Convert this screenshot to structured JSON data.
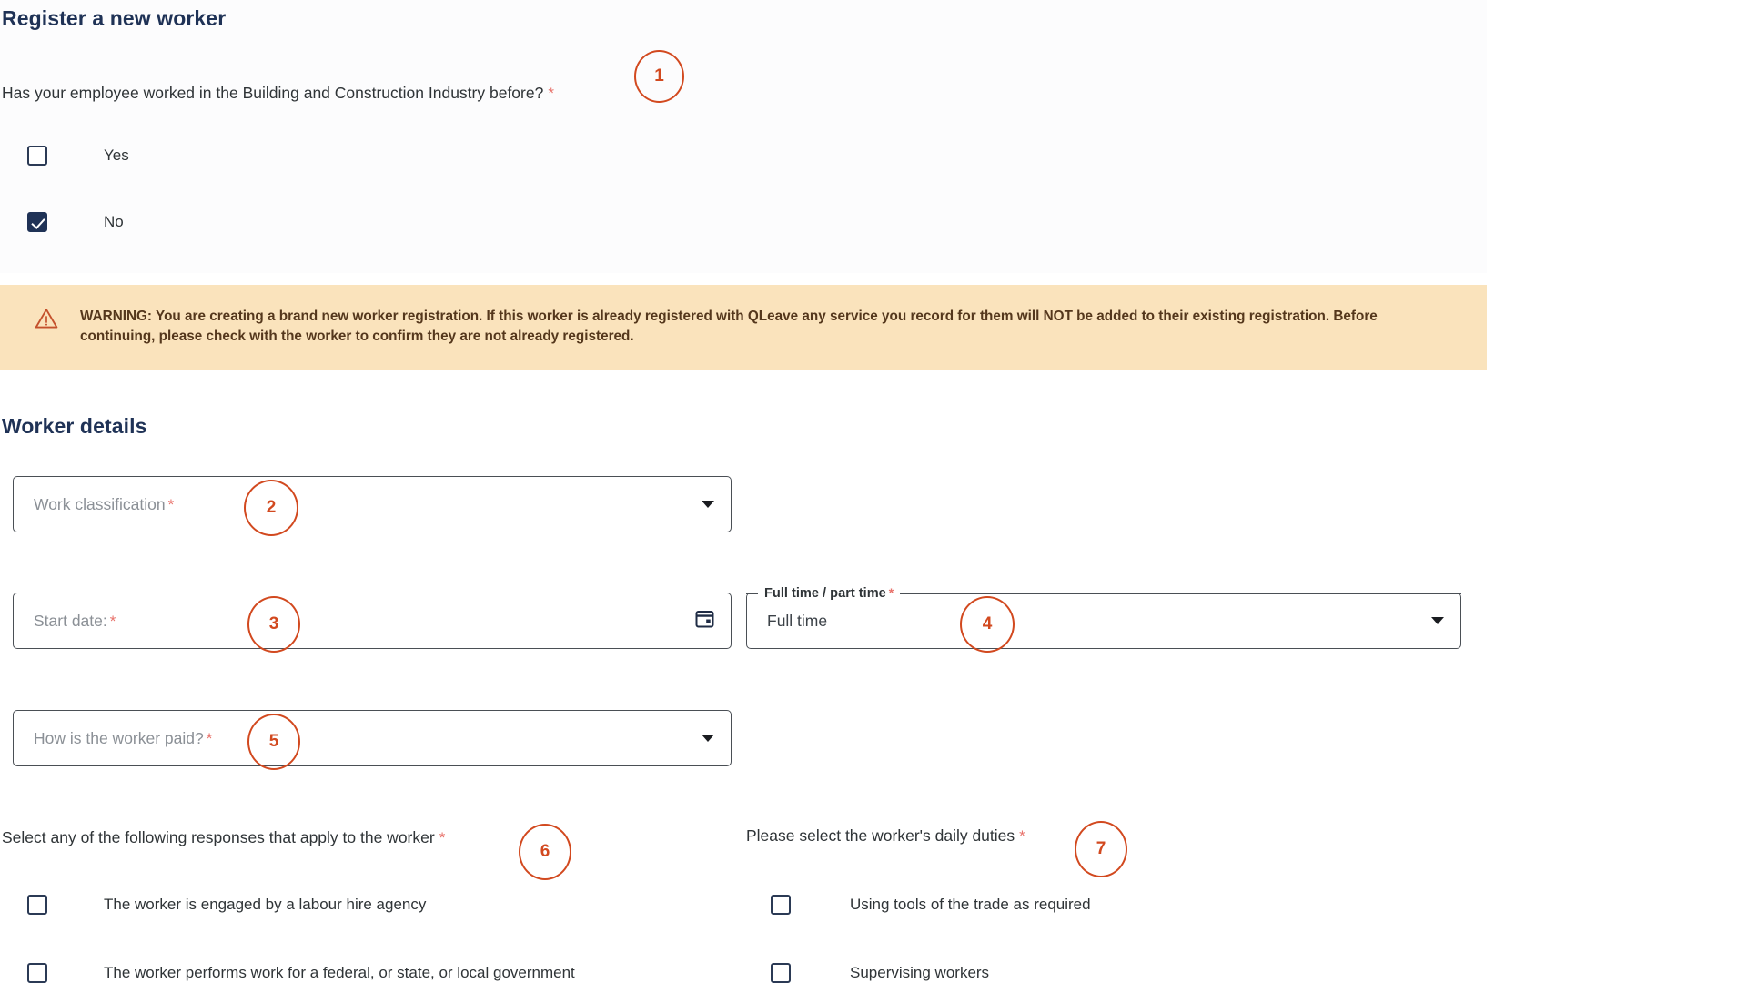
{
  "colors": {
    "heading": "#1f3256",
    "annotation": "#d2491f",
    "warning_bg": "#fae3bc",
    "warning_text": "#54371c",
    "required_star": "#e8716a",
    "checkbox_checked": "#1f3256",
    "panel_bg": "#fcfcfd"
  },
  "sections": {
    "register": {
      "title": "Register a new worker",
      "question": "Has your employee worked in the Building and Construction Industry before?",
      "required_marker": "*",
      "options": [
        {
          "label": "Yes",
          "checked": false
        },
        {
          "label": "No",
          "checked": true
        }
      ]
    },
    "warning": {
      "icon": "warning-triangle-icon",
      "text": "WARNING: You are creating a brand new worker registration. If this worker is already registered with QLeave any service you record for them will NOT be added to their existing registration. Before continuing, please check with the worker to confirm they are not already registered."
    },
    "worker_details": {
      "title": "Worker details",
      "fields": {
        "work_classification": {
          "placeholder": "Work classification",
          "required_marker": "*",
          "value": "",
          "control": "dropdown"
        },
        "start_date": {
          "placeholder": "Start date:",
          "required_marker": "*",
          "value": "",
          "control": "datepicker"
        },
        "full_time_part_time": {
          "label": "Full time / part time",
          "required_marker": "*",
          "value": "Full time",
          "control": "dropdown"
        },
        "how_paid": {
          "placeholder": "How is the worker paid?",
          "required_marker": "*",
          "value": "",
          "control": "dropdown"
        }
      },
      "responses_group": {
        "label": "Select any of the following responses that apply to the worker",
        "required_marker": "*",
        "options": [
          {
            "label": "The worker is engaged by a labour hire agency",
            "checked": false
          },
          {
            "label": "The worker performs work for a federal, or state, or local government",
            "checked": false
          }
        ]
      },
      "duties_group": {
        "label": "Please select the worker's daily duties",
        "required_marker": "*",
        "options": [
          {
            "label": "Using tools of the trade as required",
            "checked": false
          },
          {
            "label": "Supervising workers",
            "checked": false
          }
        ]
      }
    }
  },
  "annotations": [
    {
      "number": "1"
    },
    {
      "number": "2"
    },
    {
      "number": "3"
    },
    {
      "number": "4"
    },
    {
      "number": "5"
    },
    {
      "number": "6"
    },
    {
      "number": "7"
    }
  ]
}
